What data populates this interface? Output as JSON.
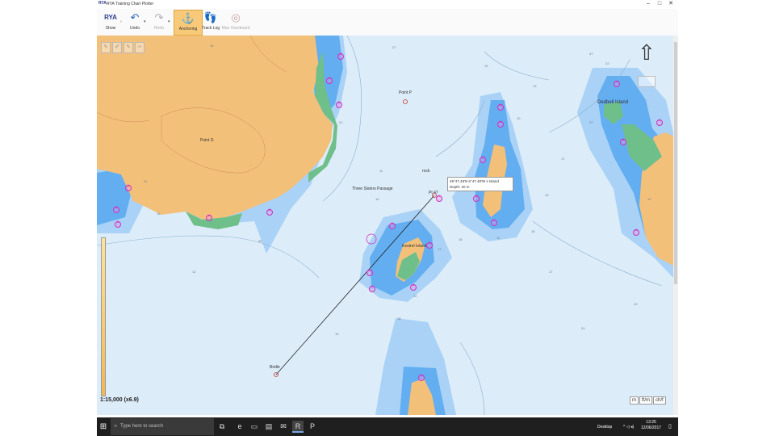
{
  "window": {
    "title": "RYA Training Chart Plotter",
    "logo": "RYA",
    "controls": [
      "–",
      "□",
      "✕"
    ]
  },
  "toolbar": {
    "buttons": [
      {
        "label": "Show",
        "icon": "rya-show-icon"
      },
      {
        "label": "Undo",
        "icon": "undo-icon"
      },
      {
        "label": "Redo",
        "icon": "redo-icon"
      },
      {
        "label": "Anchoring",
        "icon": "anchor-icon"
      },
      {
        "label": "Track Log",
        "icon": "footprints-icon"
      },
      {
        "label": "Man Overboard",
        "icon": "lifebuoy-icon"
      }
    ]
  },
  "map": {
    "place_labels": {
      "pointp": "Point P",
      "passage": "Three Sisters Passage",
      "kestrel": "Kestrel Island",
      "dedbell": "Dedbell Island",
      "rock": "rock",
      "pointg": "Point G",
      "bridle": "Bridle"
    },
    "waypoint_tag": "Pt 47",
    "tooltip": {
      "line1": "49°47.48'N 6°47.48'W",
      "line1_suffix": "s Island",
      "line2": "Depth: 20 m"
    },
    "scale": "1:15,000 (x6.9)",
    "units": [
      "m",
      "ft/m",
      "ch/f"
    ],
    "soundings": [
      "27",
      "21",
      "35",
      "12",
      "16",
      "14",
      "21",
      "15",
      "18",
      "13",
      "10",
      "10",
      "11",
      "15",
      "31",
      "17",
      "22",
      "16",
      "12",
      "13",
      "16",
      "16",
      "27",
      "13",
      "17",
      "10",
      "17",
      "47",
      "11"
    ]
  },
  "taskbar": {
    "search_placeholder": "Type here to search",
    "desktop_label": "Desktop",
    "time": "13:25",
    "date": "12/06/2017"
  },
  "colors": {
    "sea_deep": "#dcecf9",
    "sea_shallow": "#a9d2f6",
    "sea_very_shallow": "#62aef0",
    "land": "#f3c07a",
    "intertidal": "#6fbf8a",
    "marker": "#d22fbf",
    "toolbar_active": "#f7c978"
  }
}
